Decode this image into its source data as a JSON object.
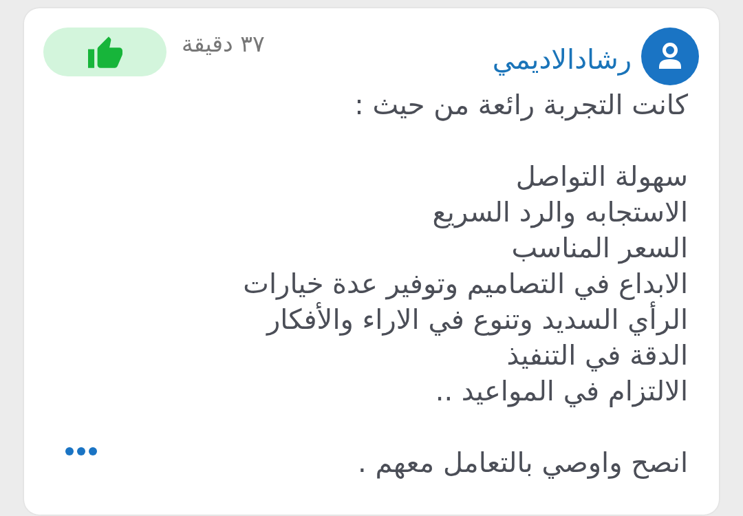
{
  "review": {
    "author": "رشادالاديمي",
    "time": "٣٧ دقيقة",
    "paragraphs": [
      {
        "lines": [
          "كانت التجربة رائعة من حيث :"
        ]
      },
      {
        "lines": [
          "سهولة التواصل",
          "الاستجابه والرد السريع",
          "السعر المناسب",
          "الابداع في التصاميم وتوفير عدة خيارات",
          "الرأي السديد وتنوع في الاراء والأفكار",
          "الدقة في التنفيذ",
          "الالتزام في المواعيد .."
        ]
      },
      {
        "lines": [
          "انصح واوصي بالتعامل معهم ."
        ]
      }
    ]
  }
}
